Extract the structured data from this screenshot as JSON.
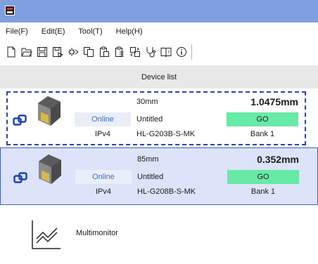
{
  "menu": {
    "items": [
      "File(F)",
      "Edit(E)",
      "Tool(T)",
      "Help(H)"
    ]
  },
  "toolbar": {
    "icons": [
      "new-file-icon",
      "open-folder-icon",
      "save-icon",
      "save-as-icon",
      "settings-export-icon",
      "copy-icon",
      "paste-icon",
      "paste-special-icon",
      "compare-icon",
      "stethoscope-icon",
      "manual-icon",
      "info-icon"
    ]
  },
  "device_list": {
    "header": "Device list",
    "devices": [
      {
        "range": "30mm",
        "name": "Untitled",
        "model": "HL-G203B-S-MK",
        "status": "Online",
        "protocol": "IPv4",
        "value": "1.0475mm",
        "result": "GO",
        "bank": "Bank 1"
      },
      {
        "range": "85mm",
        "name": "Untitled",
        "model": "HL-G208B-S-MK",
        "status": "Online",
        "protocol": "IPv4",
        "value": "0.352mm",
        "result": "GO",
        "bank": "Bank 1"
      }
    ]
  },
  "multimonitor": {
    "label": "Multimonitor"
  },
  "colors": {
    "titlebar": "#7f9fde",
    "selected_row": "#dde4fa",
    "go_green": "#66eaa6",
    "status_blue": "#3a6fd1",
    "focus_border": "#2a3dd6"
  }
}
